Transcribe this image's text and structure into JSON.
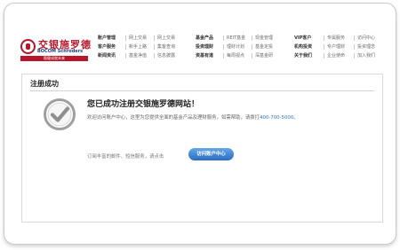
{
  "logo": {
    "chinese": "交银施罗德",
    "english": "BOCOM Schroders",
    "tagline": "稳健成就未来"
  },
  "nav": {
    "group1": [
      [
        "账户管理",
        "网上交易",
        "网上交易"
      ],
      [
        "客户服务",
        "新手上路",
        "集客查询"
      ],
      [
        "新闻资讯",
        "基金净值",
        "信息披露"
      ]
    ],
    "group2": [
      [
        "基金产品",
        "REIT基金",
        "现金管理"
      ],
      [
        "投资理财",
        "理财计划",
        "基金定投"
      ],
      [
        "资基有道",
        "每周视点",
        "深基金研"
      ]
    ],
    "group3": [
      [
        "VIP客户",
        "专属服务",
        "访问中心"
      ],
      [
        "机构投资",
        "专户理财",
        "投资理念"
      ],
      [
        "关于我们",
        "企业使命",
        "加入我们"
      ]
    ]
  },
  "content": {
    "page_title": "注册成功",
    "headline": "您已成功注册交银施罗德网站！",
    "description_prefix": "欢迎访问账户中心，这里为您提供全面的基金产品及理财服务，如需帮助，请拨打",
    "phone": "400-700-5000",
    "description_suffix": "。",
    "subscribe_text": "订阅丰富的邮件、短信服务，请点击",
    "visit_button": "访问账户中心"
  },
  "colors": {
    "brand_red": "#b8152b",
    "accent_blue": "#2f70b8"
  }
}
